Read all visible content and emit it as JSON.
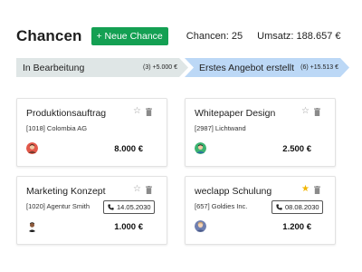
{
  "header": {
    "title": "Chancen",
    "new_button_label": "+ Neue Chance",
    "chances_stat": "Chancen: 25",
    "umsatz_stat": "Umsatz: 188.657 €"
  },
  "stages": [
    {
      "name": "In Bearbeitung",
      "meta": "(3) +5.000 €",
      "color": "#dfe6e6"
    },
    {
      "name": "Erstes Angebot erstellt",
      "meta": "(6) +15.513 €",
      "color": "#bcd8f6"
    }
  ],
  "cards": [
    {
      "title": "Produktionsauftrag",
      "subtitle": "[1018] Colombia AG",
      "amount": "8.000 €",
      "starred": false,
      "call_date": ""
    },
    {
      "title": "Whitepaper Design",
      "subtitle": "[2987] Lichtwand",
      "amount": "2.500 €",
      "starred": false,
      "call_date": ""
    },
    {
      "title": "Marketing Konzept",
      "subtitle": "[1020] Agentur Smith",
      "amount": "1.000 €",
      "starred": false,
      "call_date": "14.05.2030"
    },
    {
      "title": "weclapp Schulung",
      "subtitle": "[657] Goldies Inc.",
      "amount": "1.200 €",
      "starred": true,
      "call_date": "08.08.2030"
    }
  ],
  "icons": {
    "star": "star-icon",
    "trash": "trash-icon",
    "phone": "phone-icon"
  },
  "colors": {
    "primary_green": "#14a053",
    "star_active": "#f2b600"
  }
}
